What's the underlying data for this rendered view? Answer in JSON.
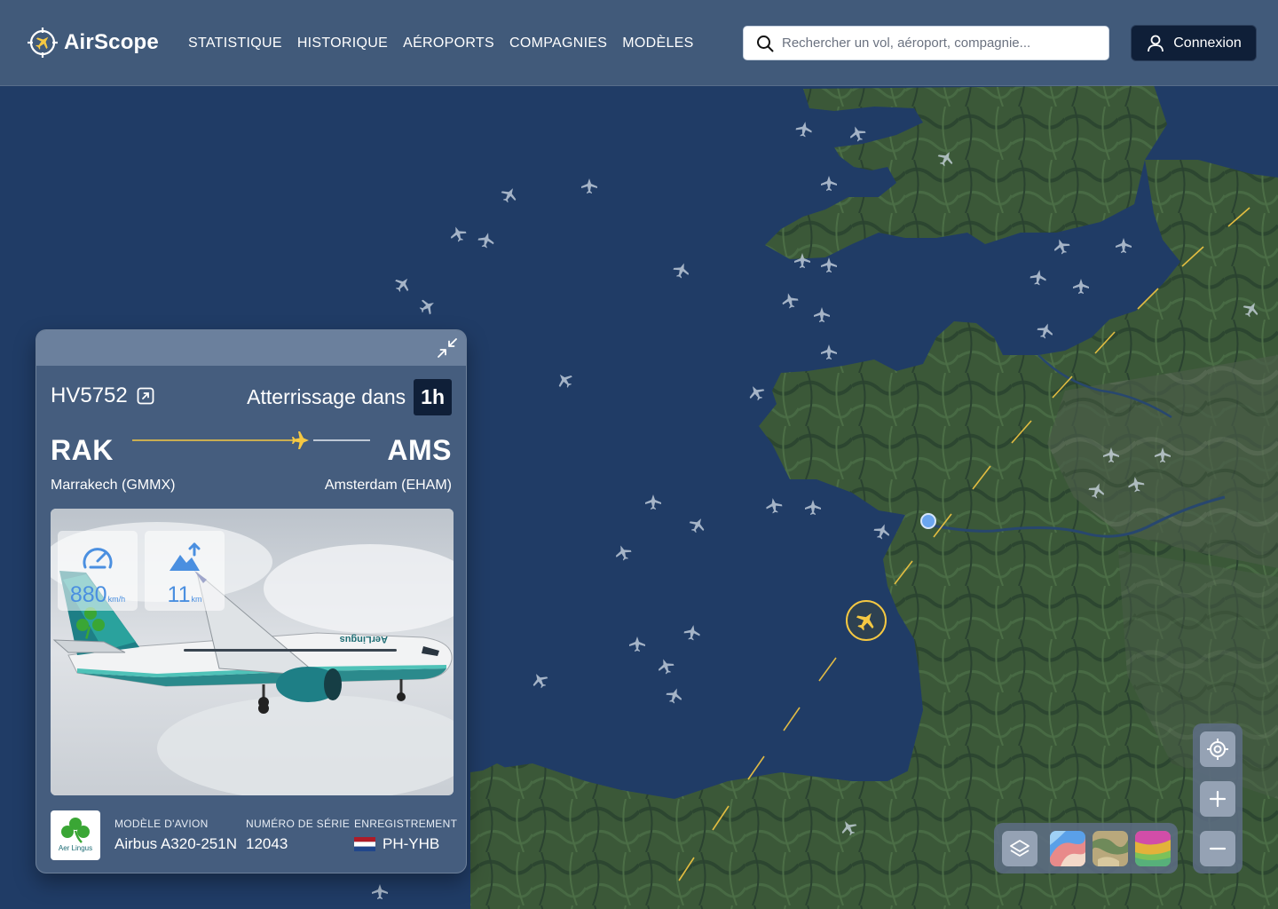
{
  "brand": {
    "name": "AirScope"
  },
  "nav": [
    {
      "label": "STATISTIQUE"
    },
    {
      "label": "HISTORIQUE"
    },
    {
      "label": "AÉROPORTS"
    },
    {
      "label": "COMPAGNIES"
    },
    {
      "label": "MODÈLES"
    }
  ],
  "search": {
    "placeholder": "Rechercher un vol, aéroport, compagnie..."
  },
  "login": {
    "label": "Connexion"
  },
  "flight": {
    "number": "HV5752",
    "landing_label": "Atterrissage dans",
    "landing_time": "1h",
    "origin": {
      "code": "RAK",
      "city": "Marrakech (GMMX)"
    },
    "destination": {
      "code": "AMS",
      "city": "Amsterdam (EHAM)"
    },
    "speed": {
      "value": "880",
      "unit": "km/h"
    },
    "altitude": {
      "value": "11",
      "unit": "km"
    },
    "airline": {
      "name": "Aer Lingus",
      "livery_text": "AerLingus"
    },
    "model": {
      "label": "MODÈLE D'AVION",
      "value": "Airbus A320-251N"
    },
    "serial": {
      "label": "NUMÉRO DE SÉRIE",
      "value": "12043"
    },
    "registration": {
      "label": "ENREGISTREMENT",
      "value": "PH-YHB",
      "country": "Netherlands"
    }
  },
  "colors": {
    "accent_yellow": "#f5c842",
    "navy": "#0f1f38",
    "stat_blue": "#4a8fe0",
    "airline_green": "#3aa635",
    "ocean": "#203c66",
    "land": "#3a5638"
  },
  "icons": {
    "logo": "plane-crosshair-icon",
    "search": "search-icon",
    "user": "user-icon",
    "external": "external-link-icon",
    "collapse": "collapse-icon",
    "speed": "speedometer-icon",
    "altitude": "altitude-icon",
    "layers": "layers-icon",
    "locate": "crosshair-icon",
    "zoom_in": "plus-icon",
    "zoom_out": "minus-icon"
  }
}
